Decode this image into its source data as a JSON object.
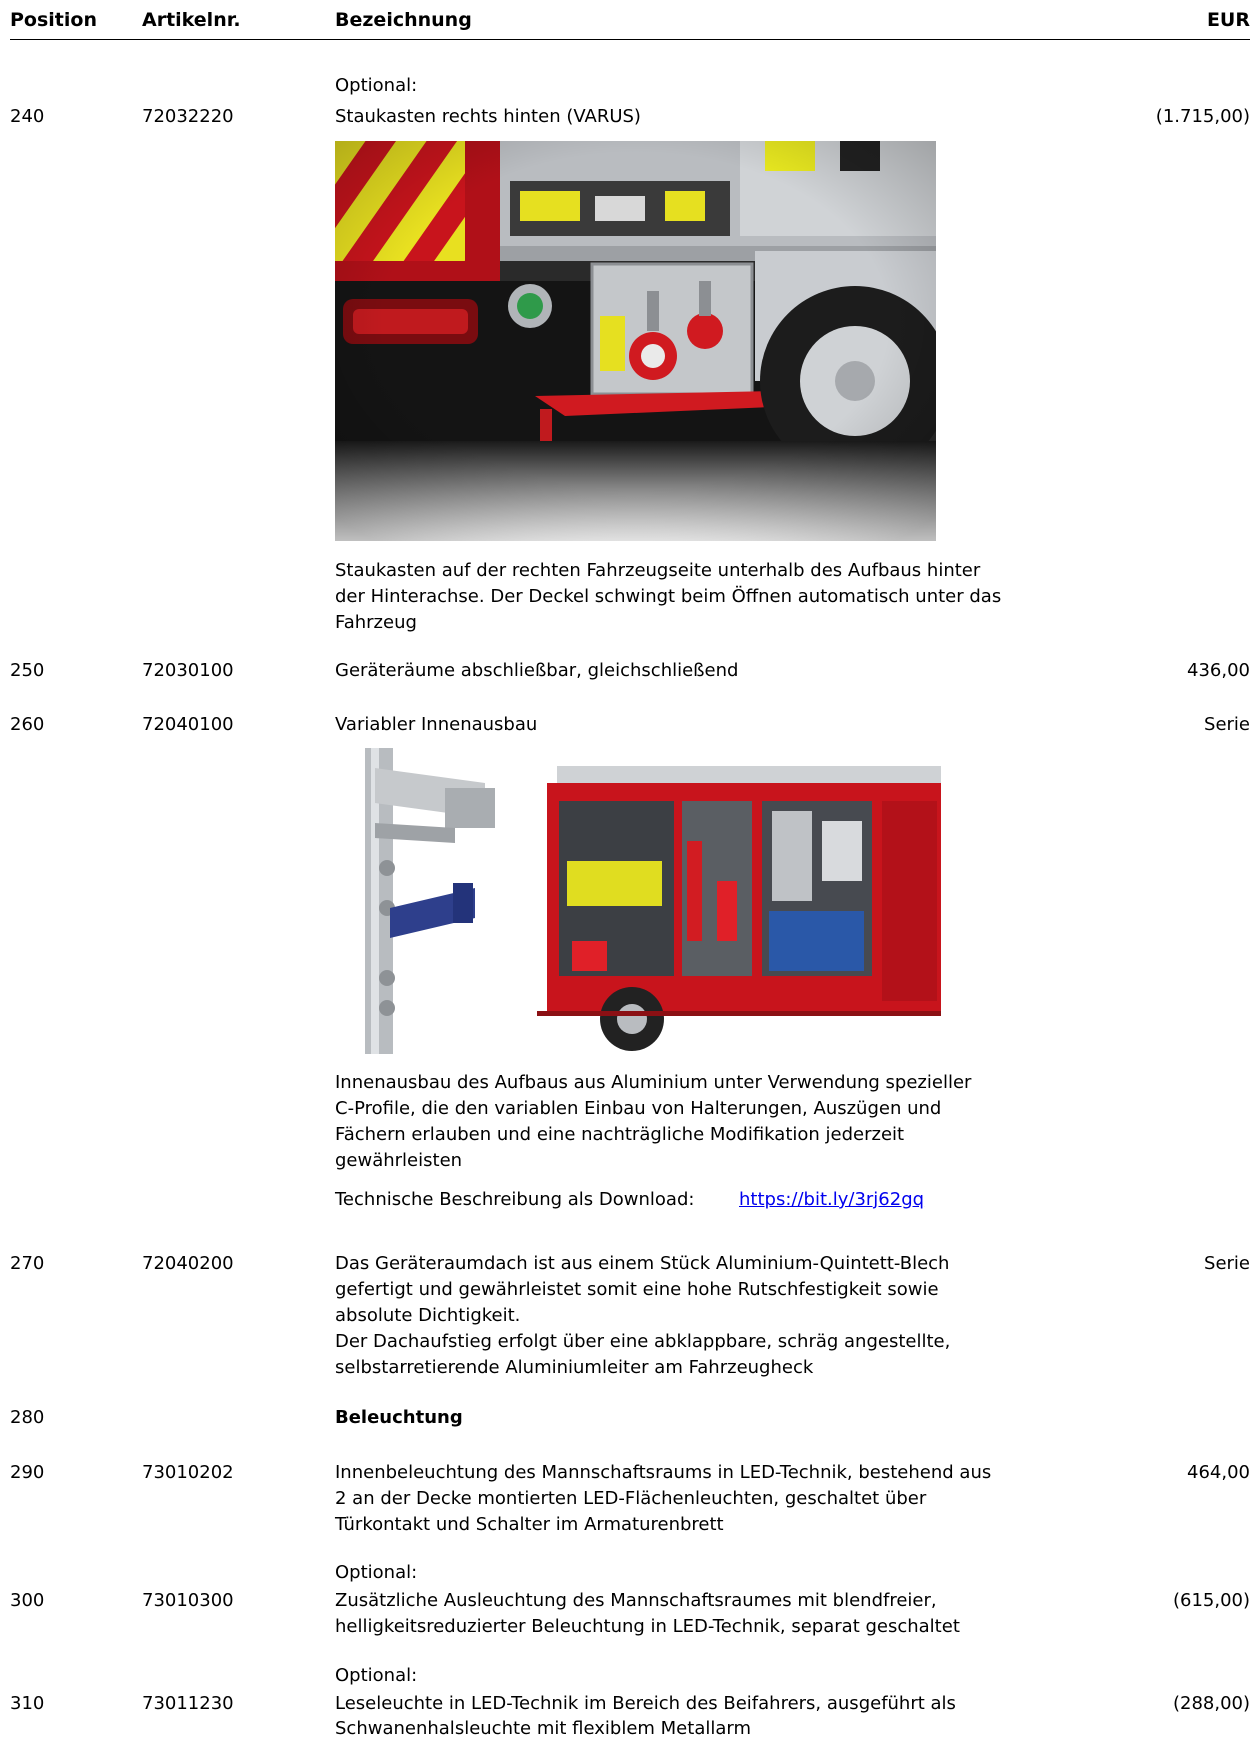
{
  "header": {
    "position": "Position",
    "artikel": "Artikelnr.",
    "bezeichnung": "Bezeichnung",
    "eur": "EUR"
  },
  "rows": [
    {
      "optional": "Optional:",
      "pos": "240",
      "art": "72032220",
      "title": "Staukasten rechts hinten (VARUS)",
      "price": "(1.715,00)",
      "desc": [
        "Staukasten auf der rechten Fahrzeugseite unterhalb des Aufbaus hinter",
        "der Hinterachse. Der Deckel schwingt beim Öffnen automatisch unter das",
        "Fahrzeug"
      ]
    },
    {
      "pos": "250",
      "art": "72030100",
      "title": "Geräteräume abschließbar, gleichschließend",
      "price": "436,00"
    },
    {
      "pos": "260",
      "art": "72040100",
      "title": "Variabler Innenausbau",
      "price": "Serie",
      "desc": [
        "Innenausbau des Aufbaus aus Aluminium unter Verwendung spezieller",
        "C-Profile, die den variablen Einbau von Halterungen, Auszügen und",
        "Fächern erlauben und eine nachträgliche Modifikation jederzeit",
        "gewährleisten"
      ],
      "download_label": "Technische Beschreibung als Download:",
      "download_link": "https://bit.ly/3rj62gq"
    },
    {
      "pos": "270",
      "art": "72040200",
      "price": "Serie",
      "lines": [
        "Das Geräteraumdach ist aus einem Stück Aluminium-Quintett-Blech",
        "gefertigt und gewährleistet somit eine hohe Rutschfestigkeit sowie",
        "absolute Dichtigkeit.",
        "Der Dachaufstieg erfolgt über eine abklappbare, schräg angestellte,",
        "selbstarretierende Aluminiumleiter am Fahrzeugheck"
      ]
    },
    {
      "pos": "280",
      "title": "Beleuchtung"
    },
    {
      "pos": "290",
      "art": "73010202",
      "price": "464,00",
      "lines": [
        "Innenbeleuchtung des Mannschaftsraums in LED-Technik, bestehend aus",
        "2 an der Decke montierten LED-Flächenleuchten, geschaltet über",
        "Türkontakt und Schalter im Armaturenbrett"
      ]
    },
    {
      "optional": "Optional:",
      "pos": "300",
      "art": "73010300",
      "price": "(615,00)",
      "lines": [
        "Zusätzliche Ausleuchtung des Mannschaftsraumes mit blendfreier,",
        "helligkeitsreduzierter Beleuchtung in LED-Technik, separat geschaltet"
      ]
    },
    {
      "optional": "Optional:",
      "pos": "310",
      "art": "73011230",
      "price": "(288,00)",
      "lines": [
        "Leseleuchte in LED-Technik im Bereich des Beifahrers, ausgeführt als",
        "Schwanenhalsleuchte mit flexiblem Metallarm"
      ]
    }
  ],
  "colors": {
    "text": "#000000",
    "link": "#0000ee",
    "fire_red": "#c8141c",
    "chrome": "#c9ccd0"
  }
}
